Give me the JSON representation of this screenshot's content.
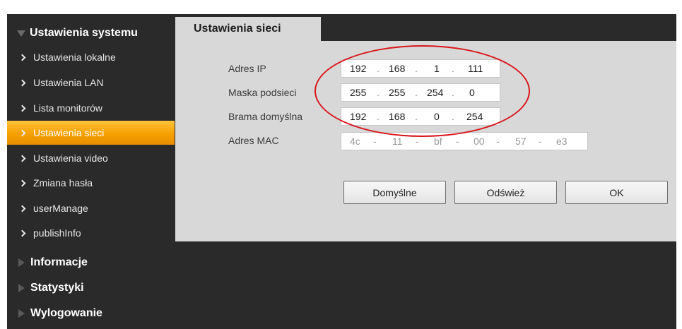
{
  "sidebar": {
    "system_settings": "Ustawienia systemu",
    "items": [
      {
        "label": "Ustawienia lokalne"
      },
      {
        "label": "Ustawienia LAN"
      },
      {
        "label": "Lista monitorów"
      },
      {
        "label": "Ustawienia sieci"
      },
      {
        "label": "Ustawienia video"
      },
      {
        "label": "Zmiana hasła"
      },
      {
        "label": "userManage"
      },
      {
        "label": "publishInfo"
      }
    ],
    "active_item": "Ustawienia sieci",
    "info": "Informacje",
    "stats": "Statystyki",
    "logout": "Wylogowanie"
  },
  "tab": {
    "title": "Ustawienia sieci"
  },
  "form": {
    "ip_label": "Adres IP",
    "ip": [
      "192",
      "168",
      "1",
      "111"
    ],
    "mask_label": "Maska podsieci",
    "mask": [
      "255",
      "255",
      "254",
      "0"
    ],
    "gateway_label": "Brama domyślna",
    "gateway": [
      "192",
      "168",
      "0",
      "254"
    ],
    "mac_label": "Adres MAC",
    "mac": [
      "4c",
      "11",
      "bf",
      "00",
      "57",
      "e3"
    ],
    "ip_separator": ".",
    "mac_separator": "-"
  },
  "buttons": {
    "default": "Domyślne",
    "refresh": "Odśwież",
    "ok": "OK"
  },
  "colors": {
    "active": "#f5a000",
    "sidebar_bg": "#2a2a2a",
    "panel_bg": "#d8d8d8",
    "annotation": "#d9161c"
  }
}
